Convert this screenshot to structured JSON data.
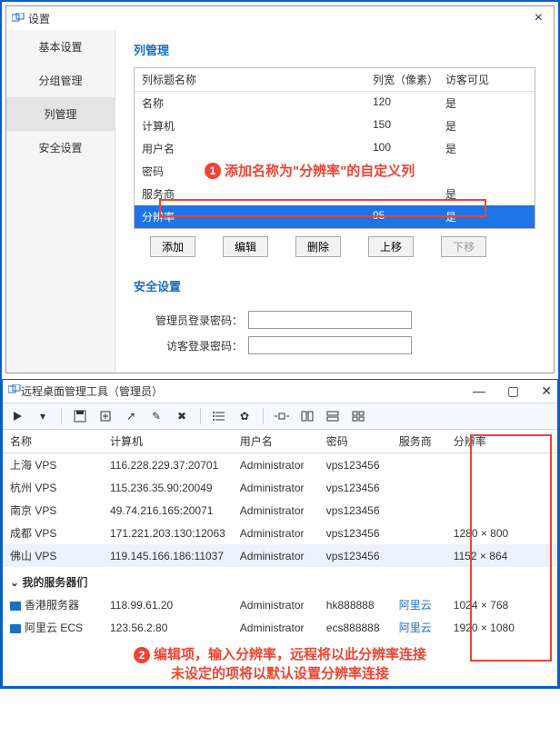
{
  "dialog": {
    "title": "设置",
    "sidebar": [
      "基本设置",
      "分组管理",
      "列管理",
      "安全设置"
    ],
    "activeTab": "列管理",
    "section1": "列管理",
    "colhead": {
      "name": "列标题名称",
      "width": "列宽（像素）",
      "visible": "访客可见"
    },
    "rows": [
      {
        "name": "名称",
        "width": "120",
        "visible": "是"
      },
      {
        "name": "计算机",
        "width": "150",
        "visible": "是"
      },
      {
        "name": "用户名",
        "width": "100",
        "visible": "是"
      },
      {
        "name": "密码",
        "width": "",
        "visible": ""
      },
      {
        "name": "服务商",
        "width": "",
        "visible": "是"
      },
      {
        "name": "分辨率",
        "width": "95",
        "visible": "是"
      }
    ],
    "buttons": {
      "add": "添加",
      "edit": "编辑",
      "del": "删除",
      "up": "上移",
      "down": "下移"
    },
    "section2": "安全设置",
    "form": {
      "admin": "管理员登录密码：",
      "guest": "访客登录密码："
    },
    "callout1": "添加名称为\"分辨率\"的自定义列"
  },
  "win": {
    "title": "远程桌面管理工具（管理员）",
    "cols": {
      "name": "名称",
      "host": "计算机",
      "user": "用户名",
      "pass": "密码",
      "vendor": "服务商",
      "res": "分辨率"
    },
    "rows": [
      {
        "name": "上海 VPS",
        "host": "116.228.229.37:20701",
        "user": "Administrator",
        "pass": "vps123456",
        "vendor": "",
        "res": ""
      },
      {
        "name": "杭州 VPS",
        "host": "115.236.35.90:20049",
        "user": "Administrator",
        "pass": "vps123456",
        "vendor": "",
        "res": ""
      },
      {
        "name": "南京 VPS",
        "host": "49.74.216.165:20071",
        "user": "Administrator",
        "pass": "vps123456",
        "vendor": "",
        "res": ""
      },
      {
        "name": "成都 VPS",
        "host": "171.221.203.130:12063",
        "user": "Administrator",
        "pass": "vps123456",
        "vendor": "",
        "res": "1280 × 800"
      },
      {
        "name": "佛山 VPS",
        "host": "119.145.166.186:11037",
        "user": "Administrator",
        "pass": "vps123456",
        "vendor": "",
        "res": "1152 × 864",
        "sel": true
      }
    ],
    "group": "我的服务器们",
    "grows": [
      {
        "name": "香港服务器",
        "host": "118.99.61.20",
        "user": "Administrator",
        "pass": "hk888888",
        "vendor": "阿里云",
        "res": "1024 × 768"
      },
      {
        "name": "阿里云 ECS",
        "host": "123.56.2.80",
        "user": "Administrator",
        "pass": "ecs888888",
        "vendor": "阿里云",
        "res": "1920 × 1080"
      }
    ],
    "callout2a": "编辑项，输入分辨率，远程将以此分辨率连接",
    "callout2b": "未设定的项将以默认设置分辨率连接"
  }
}
